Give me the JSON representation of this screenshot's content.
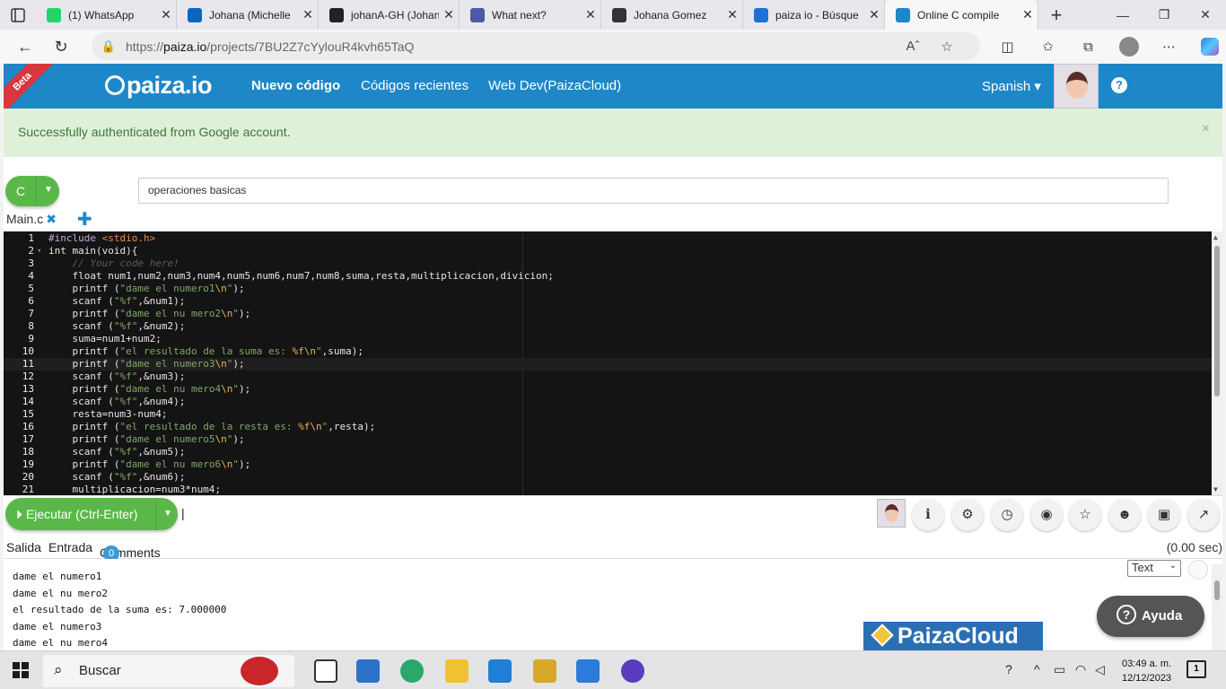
{
  "browser": {
    "tabs": [
      {
        "title": "(1) WhatsApp",
        "color": "#25d366"
      },
      {
        "title": "Johana (Michelle",
        "color": "#0a66c2"
      },
      {
        "title": "johanA-GH (Johan",
        "color": "#222222"
      },
      {
        "title": "What next?",
        "color": "#4b5aa8"
      },
      {
        "title": "Johana Gomez",
        "color": "#333333"
      },
      {
        "title": "paiza io - Búsque",
        "color": "#1e6fd9"
      },
      {
        "title": "Online C compile",
        "color": "#1e87c8"
      }
    ],
    "url_prefix": "https://",
    "url_host": "paiza.io",
    "url_path": "/projects/7BU2Z7cYylouR4kvh65TaQ"
  },
  "site": {
    "beta_label": "Beta",
    "logo_text": "paiza.io",
    "nav": [
      "Nuevo código",
      "Códigos recientes",
      "Web Dev(PaizaCloud)"
    ],
    "language_menu": "Spanish ▾",
    "help_icon": "question-circle-icon"
  },
  "alert": {
    "message": "Successfully authenticated from Google account.",
    "close": "×"
  },
  "project": {
    "language": "C",
    "title_value": "operaciones basicas",
    "file_tab": "Main.c",
    "file_close": "✖",
    "add_file": "✚"
  },
  "editor": {
    "lines": [
      {
        "n": "1",
        "html": "<span class=\"tk-pre\">#include</span> <span class=\"tk-inc\">&lt;stdio.h&gt;</span>"
      },
      {
        "n": "2",
        "html": "int main(void){",
        "fold": true
      },
      {
        "n": "3",
        "html": "    <span class=\"tk-cm\">// Your code here!</span>"
      },
      {
        "n": "4",
        "html": "    float num1,num2,num3,num4,num5,num6,num7,num8,suma,resta,multiplicacion,divicion;"
      },
      {
        "n": "5",
        "html": "    printf (<span class=\"tk-str\">\"dame el numero1</span><span class=\"tk-esc\">\\n</span><span class=\"tk-str\">\"</span>);"
      },
      {
        "n": "6",
        "html": "    scanf (<span class=\"tk-str\">\"%f\"</span>,&amp;num1);"
      },
      {
        "n": "7",
        "html": "    printf (<span class=\"tk-str\">\"dame el nu mero2</span><span class=\"tk-esc\">\\n</span><span class=\"tk-str\">\"</span>);"
      },
      {
        "n": "8",
        "html": "    scanf (<span class=\"tk-str\">\"%f\"</span>,&amp;num2);"
      },
      {
        "n": "9",
        "html": "    suma=num1+num2;"
      },
      {
        "n": "10",
        "html": "    printf (<span class=\"tk-str\">\"el resultado de la suma es: </span><span class=\"tk-esc\">%f\\n</span><span class=\"tk-str\">\"</span>,suma);"
      },
      {
        "n": "11",
        "html": "    printf (<span class=\"tk-str\">\"dame el numero3</span><span class=\"tk-esc\">\\n</span><span class=\"tk-str\">\"</span>);",
        "current": true
      },
      {
        "n": "12",
        "html": "    scanf (<span class=\"tk-str\">\"%f\"</span>,&amp;num3);"
      },
      {
        "n": "13",
        "html": "    printf (<span class=\"tk-str\">\"dame el nu mero4</span><span class=\"tk-esc\">\\n</span><span class=\"tk-str\">\"</span>);"
      },
      {
        "n": "14",
        "html": "    scanf (<span class=\"tk-str\">\"%f\"</span>,&amp;num4);"
      },
      {
        "n": "15",
        "html": "    resta=num3-num4;"
      },
      {
        "n": "16",
        "html": "    printf (<span class=\"tk-str\">\"el resultado de la resta es: </span><span class=\"tk-esc\">%f\\n</span><span class=\"tk-str\">\"</span>,resta);"
      },
      {
        "n": "17",
        "html": "    printf (<span class=\"tk-str\">\"dame el numero5</span><span class=\"tk-esc\">\\n</span><span class=\"tk-str\">\"</span>);"
      },
      {
        "n": "18",
        "html": "    scanf (<span class=\"tk-str\">\"%f\"</span>,&amp;num5);"
      },
      {
        "n": "19",
        "html": "    printf (<span class=\"tk-str\">\"dame el nu mero6</span><span class=\"tk-esc\">\\n</span><span class=\"tk-str\">\"</span>);"
      },
      {
        "n": "20",
        "html": "    scanf (<span class=\"tk-str\">\"%f\"</span>,&amp;num6);"
      },
      {
        "n": "21",
        "html": "    multiplicacion=num3*num4;"
      }
    ]
  },
  "run": {
    "label": "Ejecutar (Ctrl-Enter)",
    "tool_icons": [
      "info-icon",
      "gear-icon",
      "history-icon",
      "github-icon",
      "star-icon",
      "users-icon",
      "lock-icon",
      "share-icon"
    ],
    "tool_glyphs": [
      "ℹ",
      "⚙",
      "◷",
      "◉",
      "☆",
      "☻",
      "▣",
      "↗"
    ]
  },
  "output": {
    "tabs": [
      "Salida",
      "Entrada",
      "Comments"
    ],
    "comment_count": "0",
    "time": "(0.00 sec)",
    "format": "Text",
    "lines": [
      "dame el numero1",
      "dame el nu mero2",
      "el resultado de la suma es: 7.000000",
      "dame el numero3",
      "dame el nu mero4"
    ],
    "help_button": "Ayuda",
    "ad_text": "PaizaCloud"
  },
  "taskbar": {
    "search_label": "Buscar",
    "time": "03:49 a. m.",
    "date": "12/12/2023",
    "notifications": "1"
  }
}
